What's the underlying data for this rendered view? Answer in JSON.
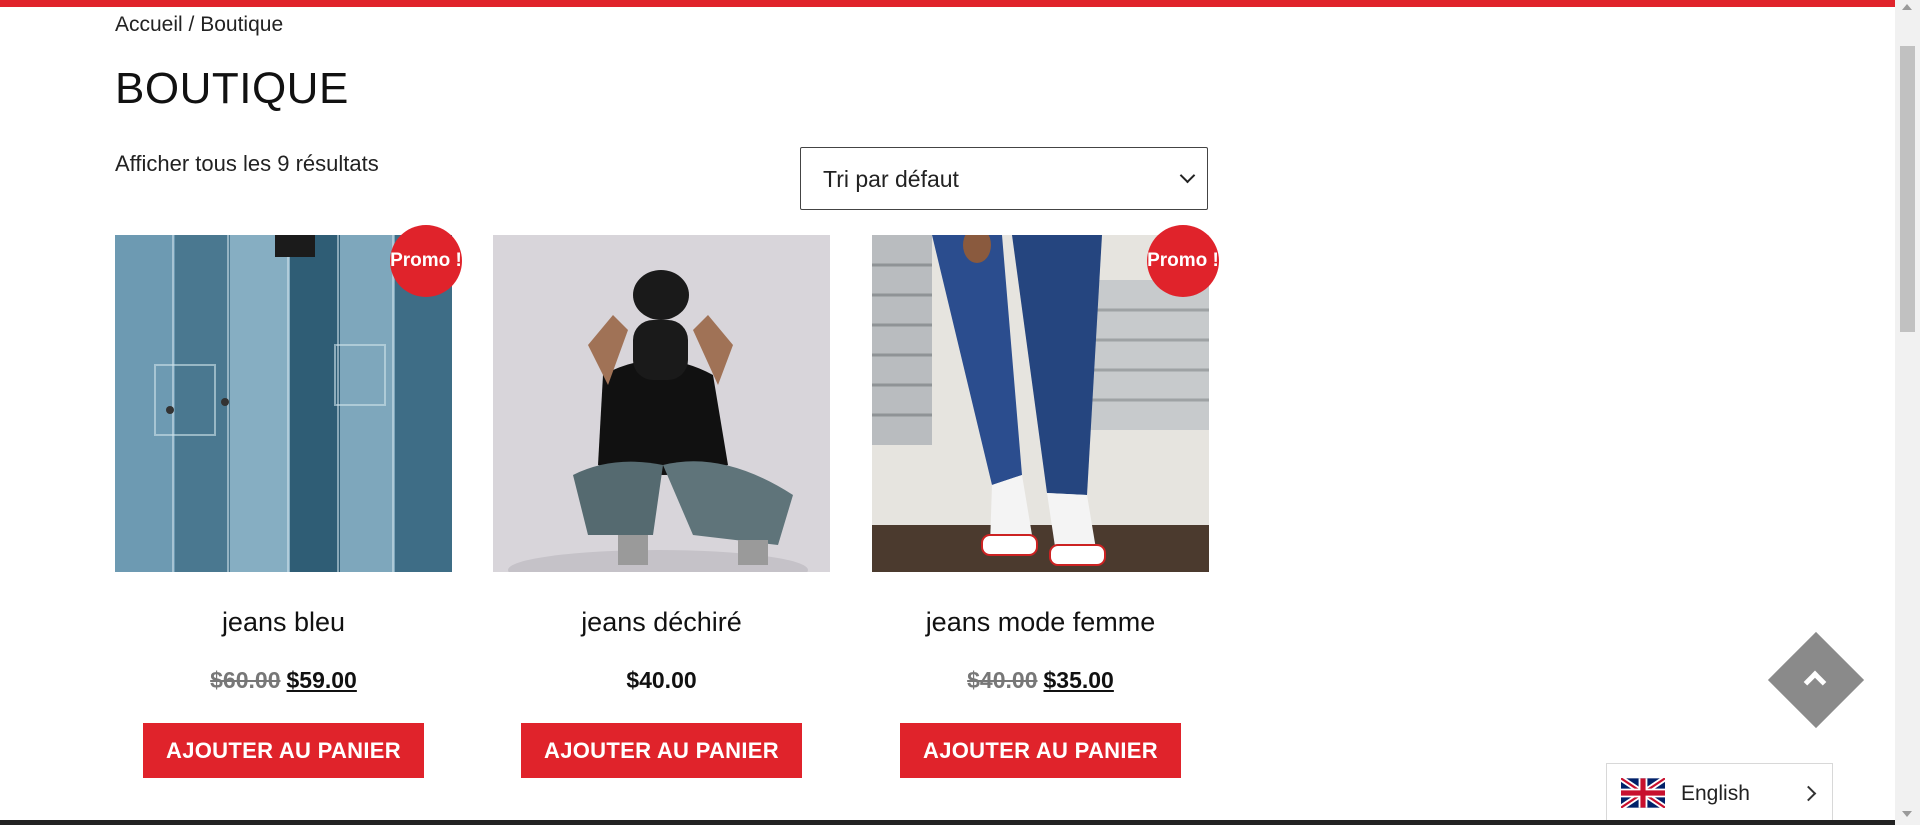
{
  "breadcrumb": {
    "home": "Accueil",
    "separator": " / ",
    "current": "Boutique"
  },
  "page": {
    "title": "BOUTIQUE",
    "result_count": "Afficher tous les 9 résultats"
  },
  "sort": {
    "selected": "Tri par défaut"
  },
  "products": [
    {
      "name": "jeans bleu",
      "badge": "Promo !",
      "old_price": "$60.00",
      "price": "$59.00",
      "button": "AJOUTER AU PANIER",
      "image": "blue-jeans-stack"
    },
    {
      "name": "jeans déchiré",
      "badge": "",
      "old_price": "",
      "price": "$40.00",
      "button": "AJOUTER AU PANIER",
      "image": "man-ripped-jeans-crouching"
    },
    {
      "name": "jeans mode femme",
      "badge": "Promo !",
      "old_price": "$40.00",
      "price": "$35.00",
      "button": "AJOUTER AU PANIER",
      "image": "woman-skinny-jeans-sneakers"
    }
  ],
  "language": {
    "label": "English",
    "flag": "uk-flag-icon"
  },
  "colors": {
    "accent": "#e0232b",
    "back_to_top": "#8a8a8a"
  },
  "icons": {
    "back_to_top": "chevron-up-icon",
    "sort": "chevron-down-icon",
    "language": "chevron-right-icon"
  }
}
